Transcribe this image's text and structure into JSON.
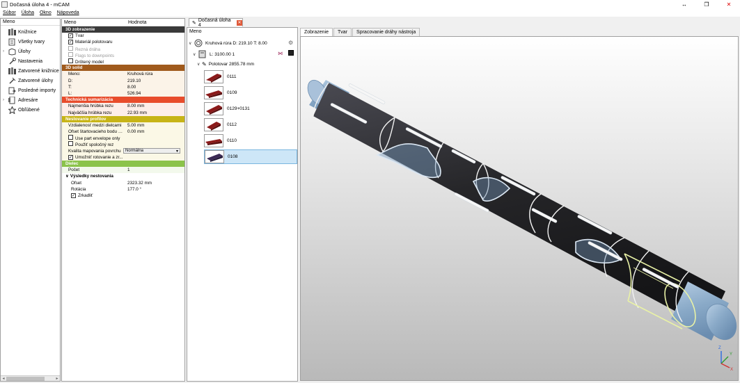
{
  "window": {
    "title": "Dočasná úloha 4 - mCAM",
    "controls": {
      "minimize": "↔",
      "maximize": "❐",
      "close": "✕"
    }
  },
  "menu": [
    "Súbor",
    "Úloha",
    "Okno",
    "Nápoveda"
  ],
  "nav": {
    "header": "Meno",
    "items": [
      {
        "label": "Knižnice",
        "icon": "books-icon",
        "expandable": false
      },
      {
        "label": "Všetky tvary",
        "icon": "shapes-icon",
        "expandable": false
      },
      {
        "label": "Úlohy",
        "icon": "tasks-icon",
        "expandable": true
      },
      {
        "label": "Nastavenia",
        "icon": "settings-icon",
        "expandable": false
      },
      {
        "label": "Zatvorené knižnice",
        "icon": "closed-library-icon",
        "expandable": false
      },
      {
        "label": "Zatvorené úlohy",
        "icon": "closed-tasks-icon",
        "expandable": false
      },
      {
        "label": "Posledné importy",
        "icon": "recent-import-icon",
        "expandable": false
      },
      {
        "label": "Adresáre",
        "icon": "directories-icon",
        "expandable": true
      },
      {
        "label": "Obľúbené",
        "icon": "star-icon",
        "expandable": false
      }
    ]
  },
  "props": {
    "col_name": "Meno",
    "col_value": "Hodnota",
    "sections": {
      "zobrazenie": "3D zobrazenie",
      "solid": "3D solid",
      "technicka": "Technická sumarizácia",
      "nestovanie": "Nestovanie profilov",
      "dielec": "Dielec",
      "vysledky": "Výsledky nestovania"
    },
    "zobrazenie_items": [
      {
        "label": "Tvar",
        "checked": true,
        "disabled": false
      },
      {
        "label": "Materiál polotovaru",
        "checked": true,
        "disabled": false
      },
      {
        "label": "Rezná dráha",
        "checked": false,
        "disabled": true
      },
      {
        "label": "Flags to downpoints",
        "checked": false,
        "disabled": true
      },
      {
        "label": "Drôtený model",
        "checked": false,
        "disabled": false
      }
    ],
    "solid": [
      {
        "name": "Meno:",
        "value": "Kruhová rúra"
      },
      {
        "name": "D:",
        "value": "219.10"
      },
      {
        "name": "T:",
        "value": "8.00"
      },
      {
        "name": "L:",
        "value": "526.94"
      }
    ],
    "technicka": [
      {
        "name": "Najmenšia hrúbka rezu",
        "value": "8.00 mm"
      },
      {
        "name": "Najväčšia hrúbka rezu",
        "value": "22.93 mm"
      }
    ],
    "nestovanie": {
      "vzdialenost": {
        "name": "Vzdialenosť medzi dielcami",
        "value": "5.00 mm"
      },
      "ofset": {
        "name": "Ofset štartovacieho bodu v...",
        "value": "0.00 mm"
      },
      "envelope": "Use part envelope only",
      "spolocny": "Použiť spoločný rez",
      "kvalita": {
        "name": "Kvalita mapovania povrchu",
        "value": "Normálna"
      },
      "rotovanie": "Umožniť rotovanie a zr..."
    },
    "dielec": {
      "name": "Počet",
      "value": "1"
    },
    "vysledky": [
      {
        "name": "Ofset",
        "value": "2323.32 mm"
      },
      {
        "name": "Rotácia",
        "value": "177.0 °"
      }
    ],
    "zrkadlit": "Zrkadliť"
  },
  "doc_tab": {
    "label": "Dočasná úloha 4",
    "close": "✕"
  },
  "tree": {
    "header": "Meno",
    "root": "Kruhová rúra D: 219.10 T: 8.00",
    "length": "L: 3100.00 1",
    "stock": "Polotovar 2855.78 mm",
    "parts": [
      "0111",
      "0109",
      "0129+0131",
      "0112",
      "0110",
      "0108"
    ],
    "selected_part": "0108"
  },
  "viewport_tabs": [
    "Zobrazenie",
    "Tvar",
    "Spracovanie dráhy nástroja"
  ],
  "axes": {
    "z": "Z",
    "y": "Y",
    "x": "X"
  },
  "colors": {
    "section_3d": "#3a3a3a",
    "section_solid": "#a05a1c",
    "section_tech": "#e84c2c",
    "section_nest": "#c7b417",
    "section_dielec": "#8bc34a",
    "selection": "#cde6f7",
    "part_red": "#8b1a1a",
    "tube_dark": "#2b2b30",
    "tube_blue": "#8fb0d0"
  }
}
